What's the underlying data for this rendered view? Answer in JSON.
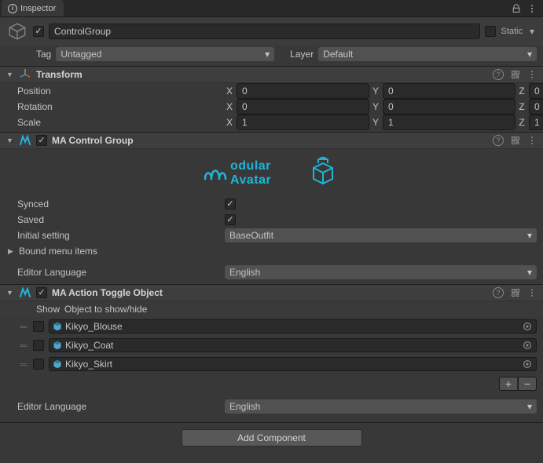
{
  "tab": {
    "title": "Inspector"
  },
  "header": {
    "active": true,
    "name": "ControlGroup",
    "static_label": "Static"
  },
  "tagRow": {
    "tag_label": "Tag",
    "tag_value": "Untagged",
    "layer_label": "Layer",
    "layer_value": "Default"
  },
  "transform": {
    "title": "Transform",
    "position": {
      "label": "Position",
      "x": "0",
      "y": "0",
      "z": "0"
    },
    "rotation": {
      "label": "Rotation",
      "x": "0",
      "y": "0",
      "z": "0"
    },
    "scale": {
      "label": "Scale",
      "x": "1",
      "y": "1",
      "z": "1"
    },
    "axis": {
      "x": "X",
      "y": "Y",
      "z": "Z"
    }
  },
  "control_group": {
    "title": "MA Control Group",
    "synced_label": "Synced",
    "saved_label": "Saved",
    "initial_label": "Initial setting",
    "initial_value": "BaseOutfit",
    "bound_label": "Bound menu items",
    "lang_label": "Editor Language",
    "lang_value": "English"
  },
  "toggle": {
    "title": "MA Action Toggle Object",
    "col_show": "Show",
    "col_obj": "Object to show/hide",
    "items": [
      {
        "name": "Kikyo_Blouse"
      },
      {
        "name": "Kikyo_Coat"
      },
      {
        "name": "Kikyo_Skirt"
      }
    ],
    "lang_label": "Editor Language",
    "lang_value": "English"
  },
  "add_component": "Add Component"
}
